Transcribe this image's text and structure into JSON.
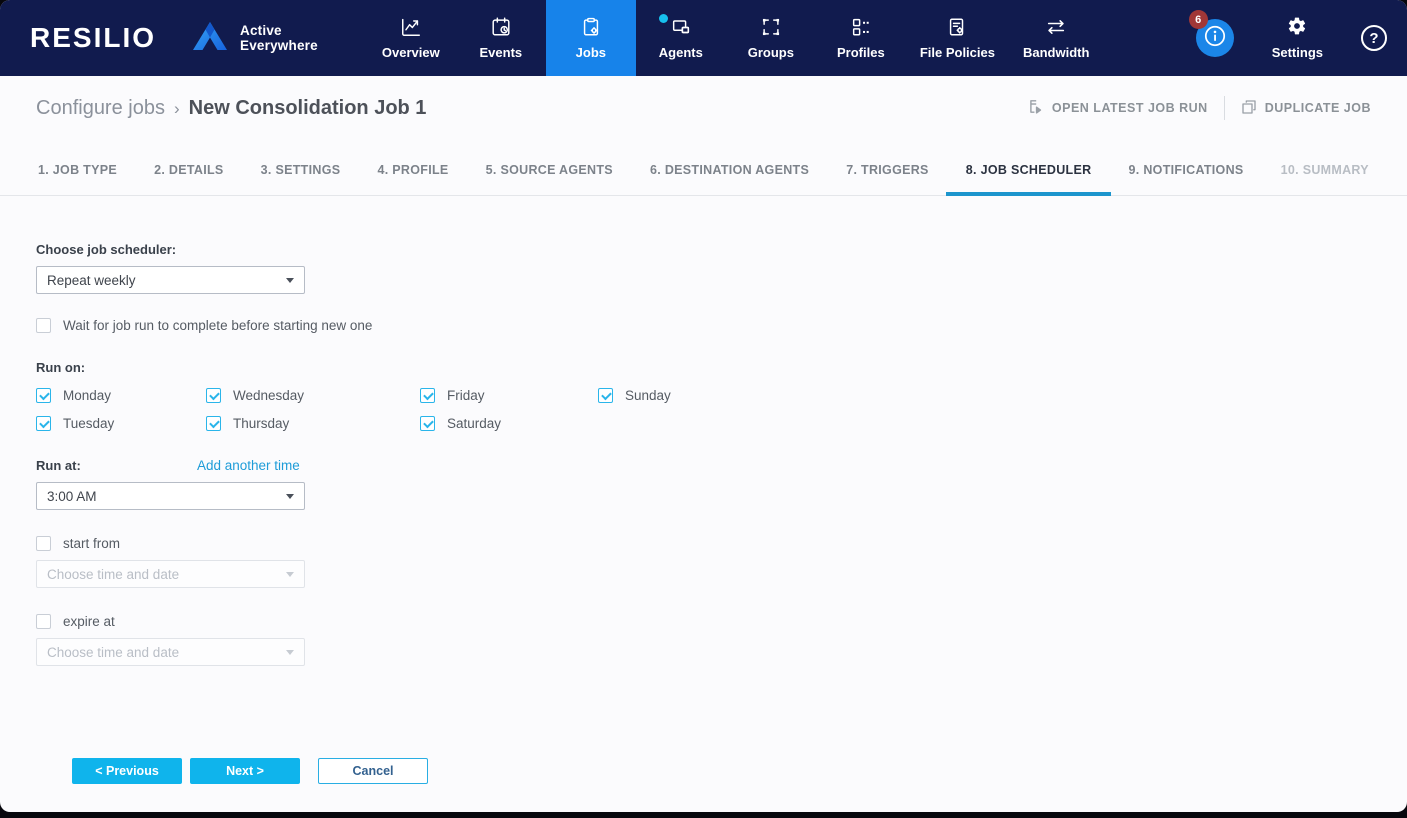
{
  "navbar": {
    "brand": "RESILIO",
    "product": {
      "line1": "Active",
      "line2": "Everywhere"
    },
    "items": [
      {
        "label": "Overview",
        "icon": "line-chart-icon",
        "active": false
      },
      {
        "label": "Events",
        "icon": "calendar-clock-icon",
        "active": false
      },
      {
        "label": "Jobs",
        "icon": "clipboard-gear-icon",
        "active": true
      },
      {
        "label": "Agents",
        "icon": "devices-icon",
        "active": false,
        "dot": true
      },
      {
        "label": "Groups",
        "icon": "group-frame-icon",
        "active": false
      },
      {
        "label": "Profiles",
        "icon": "profiles-grid-icon",
        "active": false
      },
      {
        "label": "File Policies",
        "icon": "file-gear-icon",
        "active": false
      },
      {
        "label": "Bandwidth",
        "icon": "arrows-swap-icon",
        "active": false
      }
    ],
    "notification_count": "6",
    "settings_label": "Settings",
    "help_label": "?"
  },
  "breadcrumb": {
    "parent": "Configure jobs",
    "separator": "›",
    "current": "New Consolidation Job 1"
  },
  "header_actions": {
    "open_latest_label": "OPEN LATEST JOB RUN",
    "duplicate_label": "DUPLICATE JOB"
  },
  "tabs": [
    {
      "label": "1. JOB TYPE",
      "state": "normal"
    },
    {
      "label": "2. DETAILS",
      "state": "normal"
    },
    {
      "label": "3. SETTINGS",
      "state": "normal"
    },
    {
      "label": "4. PROFILE",
      "state": "normal"
    },
    {
      "label": "5. SOURCE AGENTS",
      "state": "normal"
    },
    {
      "label": "6. DESTINATION AGENTS",
      "state": "normal"
    },
    {
      "label": "7. TRIGGERS",
      "state": "normal"
    },
    {
      "label": "8. JOB SCHEDULER",
      "state": "active"
    },
    {
      "label": "9. NOTIFICATIONS",
      "state": "normal"
    },
    {
      "label": "10. SUMMARY",
      "state": "disabled"
    }
  ],
  "form": {
    "scheduler_label": "Choose job scheduler:",
    "scheduler_value": "Repeat weekly",
    "wait_checkbox_label": "Wait for job run to complete before starting new one",
    "wait_checkbox_checked": false,
    "run_on_label": "Run on:",
    "days": [
      {
        "label": "Monday",
        "checked": true
      },
      {
        "label": "Tuesday",
        "checked": true
      },
      {
        "label": "Wednesday",
        "checked": true
      },
      {
        "label": "Thursday",
        "checked": true
      },
      {
        "label": "Friday",
        "checked": true
      },
      {
        "label": "Saturday",
        "checked": true
      },
      {
        "label": "Sunday",
        "checked": true
      }
    ],
    "run_at_label": "Run at:",
    "add_time_link": "Add another time",
    "run_at_value": "3:00 AM",
    "start_from": {
      "label": "start from",
      "checked": false,
      "placeholder": "Choose time and date"
    },
    "expire_at": {
      "label": "expire at",
      "checked": false,
      "placeholder": "Choose time and date"
    }
  },
  "footer": {
    "previous_label": "< Previous",
    "next_label": "Next >",
    "cancel_label": "Cancel"
  },
  "colors": {
    "navbar_bg": "#111b4e",
    "nav_active_bg": "#1783ea",
    "accent_cyan": "#0fb4ec",
    "checkbox_cyan": "#2ab5ea",
    "link_blue": "#1e9cd8",
    "tab_underline": "#1c95cd",
    "badge_red": "#a13737",
    "info_circle_blue": "#1b86e8",
    "agent_dot_cyan": "#17c0ee"
  }
}
